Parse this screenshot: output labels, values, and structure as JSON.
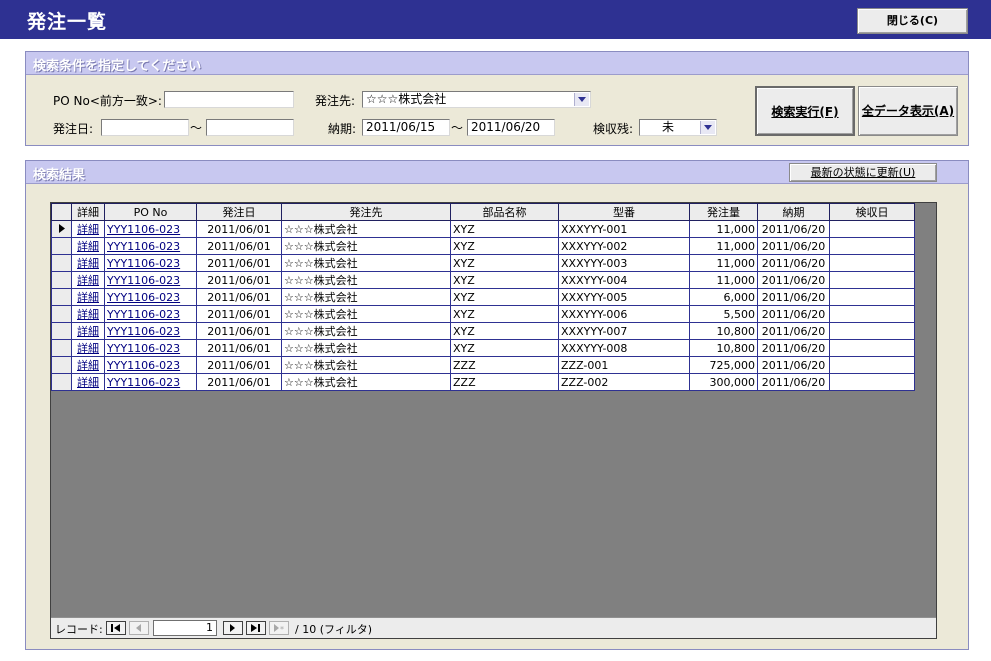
{
  "window": {
    "title": "発注一覧",
    "close_label": "閉じる(C)"
  },
  "search": {
    "panel_title": "検索条件を指定してください",
    "po_no_label": "PO No<前方一致>:",
    "po_no_value": "",
    "supplier_label": "発注先:",
    "supplier_value": "☆☆☆株式会社",
    "order_date_label": "発注日:",
    "order_date_from": "",
    "order_date_to": "",
    "range_sep": "〜",
    "due_label": "納期:",
    "due_from": "2011/06/15",
    "due_to": "2011/06/20",
    "inspect_label": "検収残:",
    "inspect_value": "未",
    "search_button": "検索実行(F)",
    "showall_button": "全データ表示(A)"
  },
  "results": {
    "panel_title": "検索結果",
    "refresh_button": "最新の状態に更新(U)",
    "columns": [
      "詳細",
      "PO No",
      "発注日",
      "発注先",
      "部品名称",
      "型番",
      "発注量",
      "納期",
      "検収日"
    ],
    "rows": [
      {
        "detail": "詳細",
        "po": "YYY1106-023",
        "date": "2011/06/01",
        "supplier": "☆☆☆株式会社",
        "part": "XYZ",
        "model": "XXXYYY-001",
        "qty": "11,000",
        "due": "2011/06/20",
        "inspected": ""
      },
      {
        "detail": "詳細",
        "po": "YYY1106-023",
        "date": "2011/06/01",
        "supplier": "☆☆☆株式会社",
        "part": "XYZ",
        "model": "XXXYYY-002",
        "qty": "11,000",
        "due": "2011/06/20",
        "inspected": ""
      },
      {
        "detail": "詳細",
        "po": "YYY1106-023",
        "date": "2011/06/01",
        "supplier": "☆☆☆株式会社",
        "part": "XYZ",
        "model": "XXXYYY-003",
        "qty": "11,000",
        "due": "2011/06/20",
        "inspected": ""
      },
      {
        "detail": "詳細",
        "po": "YYY1106-023",
        "date": "2011/06/01",
        "supplier": "☆☆☆株式会社",
        "part": "XYZ",
        "model": "XXXYYY-004",
        "qty": "11,000",
        "due": "2011/06/20",
        "inspected": ""
      },
      {
        "detail": "詳細",
        "po": "YYY1106-023",
        "date": "2011/06/01",
        "supplier": "☆☆☆株式会社",
        "part": "XYZ",
        "model": "XXXYYY-005",
        "qty": "6,000",
        "due": "2011/06/20",
        "inspected": ""
      },
      {
        "detail": "詳細",
        "po": "YYY1106-023",
        "date": "2011/06/01",
        "supplier": "☆☆☆株式会社",
        "part": "XYZ",
        "model": "XXXYYY-006",
        "qty": "5,500",
        "due": "2011/06/20",
        "inspected": ""
      },
      {
        "detail": "詳細",
        "po": "YYY1106-023",
        "date": "2011/06/01",
        "supplier": "☆☆☆株式会社",
        "part": "XYZ",
        "model": "XXXYYY-007",
        "qty": "10,800",
        "due": "2011/06/20",
        "inspected": ""
      },
      {
        "detail": "詳細",
        "po": "YYY1106-023",
        "date": "2011/06/01",
        "supplier": "☆☆☆株式会社",
        "part": "XYZ",
        "model": "XXXYYY-008",
        "qty": "10,800",
        "due": "2011/06/20",
        "inspected": ""
      },
      {
        "detail": "詳細",
        "po": "YYY1106-023",
        "date": "2011/06/01",
        "supplier": "☆☆☆株式会社",
        "part": "ZZZ",
        "model": "ZZZ-001",
        "qty": "725,000",
        "due": "2011/06/20",
        "inspected": ""
      },
      {
        "detail": "詳細",
        "po": "YYY1106-023",
        "date": "2011/06/01",
        "supplier": "☆☆☆株式会社",
        "part": "ZZZ",
        "model": "ZZZ-002",
        "qty": "300,000",
        "due": "2011/06/20",
        "inspected": ""
      }
    ],
    "current_row_index": 0
  },
  "navigator": {
    "label": "レコード:",
    "current": "1",
    "total": "/ 10 (フィルタ)"
  },
  "colors": {
    "title_bar": "#2e3192",
    "panel_header": "#c8c8f0",
    "panel_bg": "#ece9d8",
    "grid_border": "#2e3192",
    "link": "#000080"
  }
}
